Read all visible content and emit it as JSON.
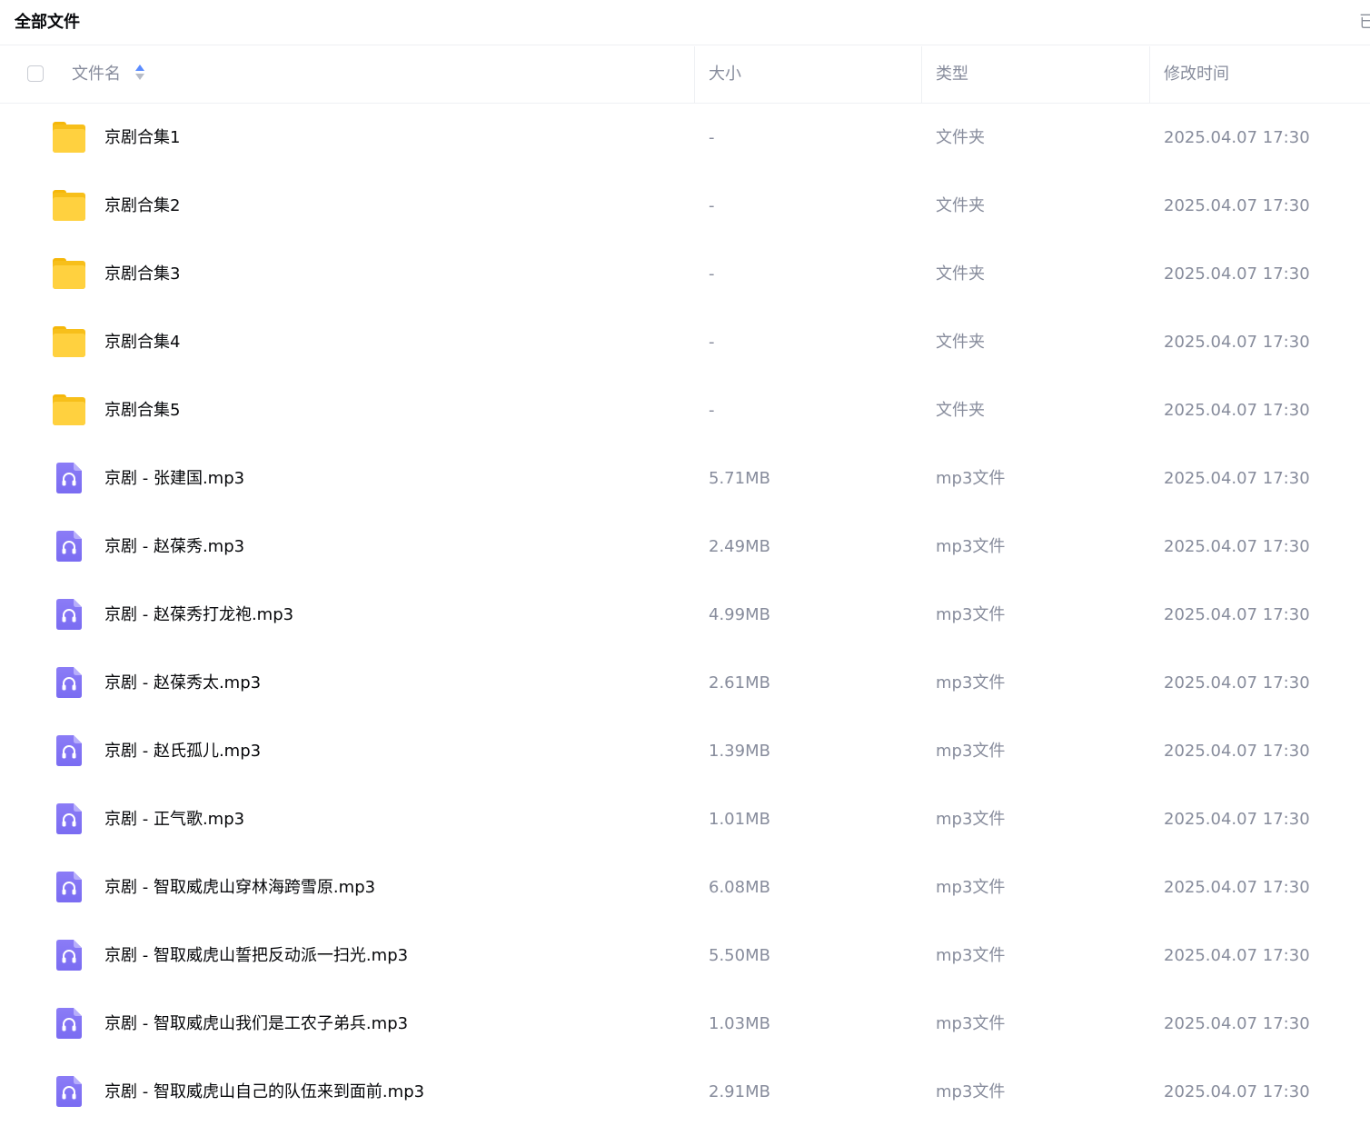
{
  "header": {
    "title": "全部文件",
    "right_hint": "已"
  },
  "columns": {
    "name": "文件名",
    "size": "大小",
    "type": "类型",
    "modified": "修改时间"
  },
  "colors": {
    "folder": "#ffd13f",
    "audio": "#8b7cf6",
    "sort_active": "#5b8cff"
  },
  "files": [
    {
      "name": "京剧合集1",
      "size": "-",
      "type": "文件夹",
      "modified": "2025.04.07 17:30",
      "icon": "folder-icon"
    },
    {
      "name": "京剧合集2",
      "size": "-",
      "type": "文件夹",
      "modified": "2025.04.07 17:30",
      "icon": "folder-icon"
    },
    {
      "name": "京剧合集3",
      "size": "-",
      "type": "文件夹",
      "modified": "2025.04.07 17:30",
      "icon": "folder-icon"
    },
    {
      "name": "京剧合集4",
      "size": "-",
      "type": "文件夹",
      "modified": "2025.04.07 17:30",
      "icon": "folder-icon"
    },
    {
      "name": "京剧合集5",
      "size": "-",
      "type": "文件夹",
      "modified": "2025.04.07 17:30",
      "icon": "folder-icon"
    },
    {
      "name": "京剧 - 张建国.mp3",
      "size": "5.71MB",
      "type": "mp3文件",
      "modified": "2025.04.07 17:30",
      "icon": "audio-file-icon"
    },
    {
      "name": "京剧 - 赵葆秀.mp3",
      "size": "2.49MB",
      "type": "mp3文件",
      "modified": "2025.04.07 17:30",
      "icon": "audio-file-icon"
    },
    {
      "name": "京剧 - 赵葆秀打龙袍.mp3",
      "size": "4.99MB",
      "type": "mp3文件",
      "modified": "2025.04.07 17:30",
      "icon": "audio-file-icon"
    },
    {
      "name": "京剧 - 赵葆秀太.mp3",
      "size": "2.61MB",
      "type": "mp3文件",
      "modified": "2025.04.07 17:30",
      "icon": "audio-file-icon"
    },
    {
      "name": "京剧 - 赵氏孤儿.mp3",
      "size": "1.39MB",
      "type": "mp3文件",
      "modified": "2025.04.07 17:30",
      "icon": "audio-file-icon"
    },
    {
      "name": "京剧 - 正气歌.mp3",
      "size": "1.01MB",
      "type": "mp3文件",
      "modified": "2025.04.07 17:30",
      "icon": "audio-file-icon"
    },
    {
      "name": "京剧 - 智取威虎山穿林海跨雪原.mp3",
      "size": "6.08MB",
      "type": "mp3文件",
      "modified": "2025.04.07 17:30",
      "icon": "audio-file-icon"
    },
    {
      "name": "京剧 - 智取威虎山誓把反动派一扫光.mp3",
      "size": "5.50MB",
      "type": "mp3文件",
      "modified": "2025.04.07 17:30",
      "icon": "audio-file-icon"
    },
    {
      "name": "京剧 - 智取威虎山我们是工农子弟兵.mp3",
      "size": "1.03MB",
      "type": "mp3文件",
      "modified": "2025.04.07 17:30",
      "icon": "audio-file-icon"
    },
    {
      "name": "京剧 - 智取威虎山自己的队伍来到面前.mp3",
      "size": "2.91MB",
      "type": "mp3文件",
      "modified": "2025.04.07 17:30",
      "icon": "audio-file-icon"
    }
  ]
}
